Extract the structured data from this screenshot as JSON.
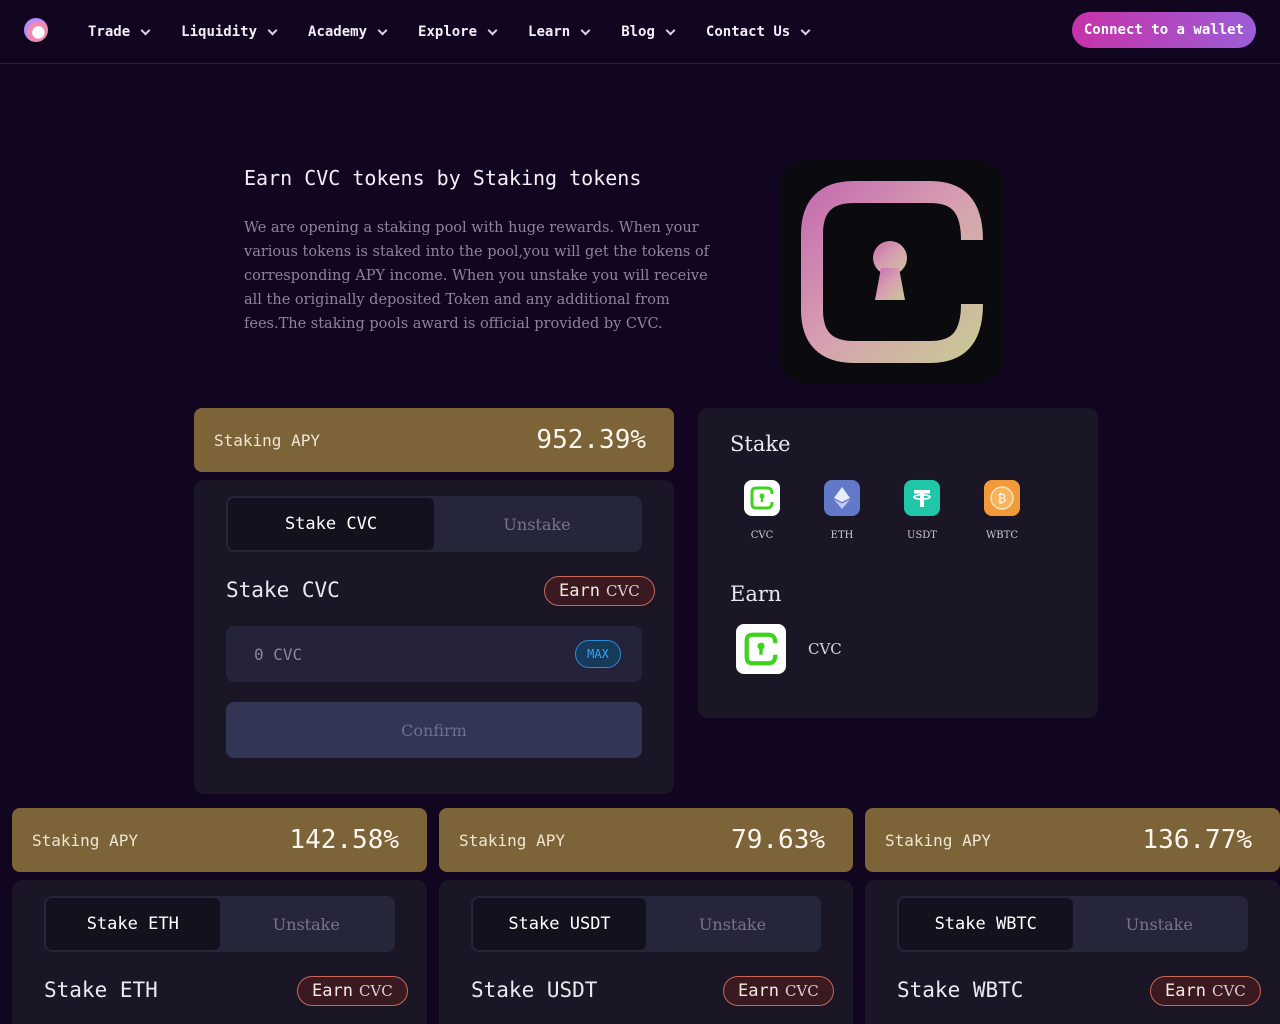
{
  "nav": {
    "items": [
      {
        "label": "Trade"
      },
      {
        "label": "Liquidity"
      },
      {
        "label": "Academy"
      },
      {
        "label": "Explore"
      },
      {
        "label": "Learn"
      },
      {
        "label": "Blog"
      },
      {
        "label": "Contact Us"
      }
    ],
    "connect_label": "Connect to a wallet"
  },
  "hero": {
    "title": "Earn CVC tokens by Staking tokens",
    "description": "We are opening a staking pool with huge rewards. When your various tokens is staked into the pool,you will get the tokens of corresponding APY income. When you unstake you will receive all the originally deposited Token and any additional from fees.The staking pools award is official provided by CVC."
  },
  "main_pool": {
    "apy_label": "Staking APY",
    "apy_value": "952.39%",
    "tab_stake": "Stake CVC",
    "tab_unstake": "Unstake",
    "heading": "Stake CVC",
    "earn_badge_main": "Earn",
    "earn_badge_sub": "CVC",
    "amount_placeholder": "0 CVC",
    "max_label": "MAX",
    "confirm_label": "Confirm"
  },
  "token_card": {
    "stake_title": "Stake",
    "earn_title": "Earn",
    "tokens": [
      {
        "label": "CVC",
        "icon": "cvc-icon",
        "color": "#ffffff"
      },
      {
        "label": "ETH",
        "icon": "eth-icon",
        "color": "#6278c8"
      },
      {
        "label": "USDT",
        "icon": "usdt-icon",
        "color": "#1fc6a8"
      },
      {
        "label": "WBTC",
        "icon": "wbtc-icon",
        "color": "#f29a3a"
      }
    ],
    "earn_token_label": "CVC"
  },
  "pools": [
    {
      "apy_label": "Staking APY",
      "apy_value": "142.58%",
      "tab_stake": "Stake ETH",
      "tab_unstake": "Unstake",
      "heading": "Stake ETH",
      "earn_main": "Earn",
      "earn_sub": "CVC"
    },
    {
      "apy_label": "Staking APY",
      "apy_value": "79.63%",
      "tab_stake": "Stake USDT",
      "tab_unstake": "Unstake",
      "heading": "Stake USDT",
      "earn_main": "Earn",
      "earn_sub": "CVC"
    },
    {
      "apy_label": "Staking APY",
      "apy_value": "136.77%",
      "tab_stake": "Stake WBTC",
      "tab_unstake": "Unstake",
      "heading": "Stake WBTC",
      "earn_main": "Earn",
      "earn_sub": "CVC"
    }
  ],
  "colors": {
    "background": "#120520",
    "apy_banner": "#7c6338",
    "accent_gradient_start": "#c732a8",
    "accent_gradient_end": "#9b5ed8",
    "cvc_green": "#3ed11e"
  }
}
